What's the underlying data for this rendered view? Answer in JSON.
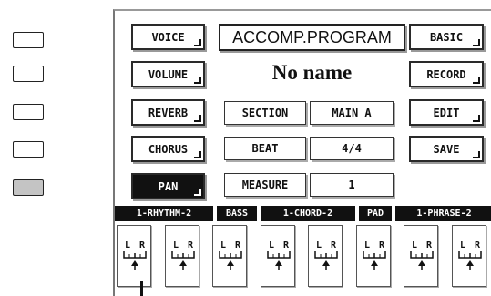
{
  "left_panel": {
    "buttons": [
      {
        "id": "btn-1",
        "active": false
      },
      {
        "id": "btn-2",
        "active": false
      },
      {
        "id": "btn-3",
        "active": false
      },
      {
        "id": "btn-4",
        "active": false
      },
      {
        "id": "btn-5",
        "active": true
      }
    ]
  },
  "left_column": {
    "voice": "VOICE",
    "volume": "VOLUME",
    "reverb": "REVERB",
    "chorus": "CHORUS",
    "pan": "PAN"
  },
  "center": {
    "title": "ACCOMP.PROGRAM",
    "song_name": "No name",
    "section_label": "SECTION",
    "section_value": "MAIN A",
    "beat_label": "BEAT",
    "beat_value": "4/4",
    "measure_label": "MEASURE",
    "measure_value": "1"
  },
  "right_column": {
    "basic": "BASIC",
    "record": "RECORD",
    "edit": "EDIT",
    "save": "SAVE"
  },
  "parts": [
    "1-RHYTHM-2",
    "BASS",
    "1-CHORD-2",
    "PAD",
    "1-PHRASE-2"
  ],
  "pan_channels": {
    "left_label": "L",
    "right_label": "R",
    "count": 8
  },
  "colors": {
    "active_side_button": "#c4c4c4",
    "selected_button": "#111111"
  }
}
